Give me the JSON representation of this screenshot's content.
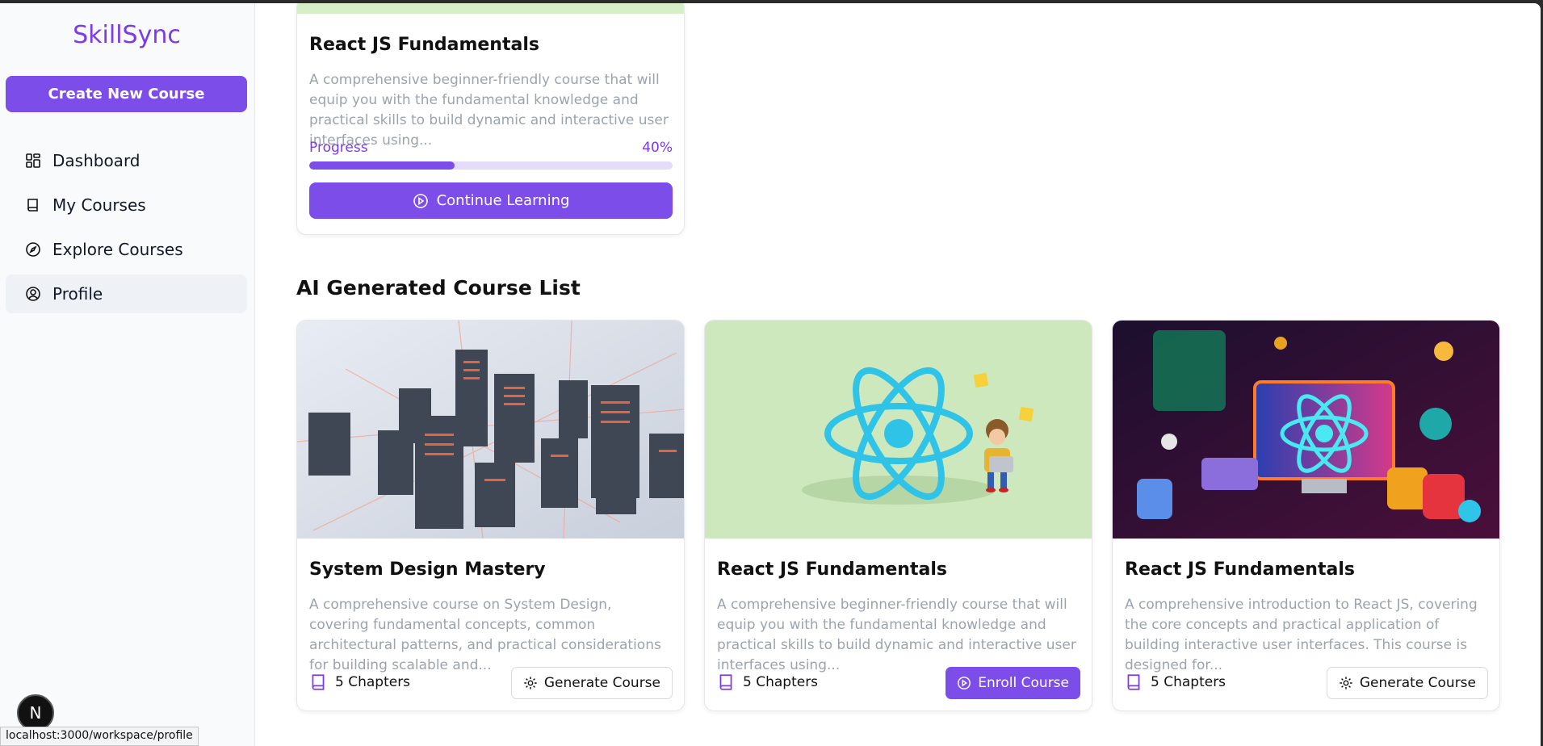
{
  "sidebar": {
    "brand": "SkillSync",
    "create_label": "Create New Course",
    "items": [
      {
        "label": "Dashboard",
        "icon": "dashboard-icon"
      },
      {
        "label": "My Courses",
        "icon": "book-icon"
      },
      {
        "label": "Explore Courses",
        "icon": "compass-icon"
      },
      {
        "label": "Profile",
        "icon": "user-circle-icon",
        "active": true
      }
    ]
  },
  "enrolled": {
    "title": "React JS Fundamentals",
    "description": "A comprehensive beginner-friendly course that will equip you with the fundamental knowledge and practical skills to build dynamic and interactive user interfaces using...",
    "progress_label": "Progress",
    "progress_value": "40%",
    "progress_fraction": 0.4,
    "button_label": "Continue Learning"
  },
  "section_title": "AI Generated Course List",
  "courses": [
    {
      "title": "System Design Mastery",
      "description": "A comprehensive course on System Design, covering fundamental concepts, common architectural patterns, and practical considerations for building scalable and...",
      "chapters": "5 Chapters",
      "action": "Generate Course"
    },
    {
      "title": "React JS Fundamentals",
      "description": "A comprehensive beginner-friendly course that will equip you with the fundamental knowledge and practical skills to build dynamic and interactive user interfaces using...",
      "chapters": "5 Chapters",
      "action": "Enroll Course"
    },
    {
      "title": "React JS Fundamentals",
      "description": "A comprehensive introduction to React JS, covering the core concepts and practical application of building interactive user interfaces. This course is designed for...",
      "chapters": "5 Chapters",
      "action": "Generate Course"
    }
  ],
  "status_url": "localhost:3000/workspace/profile",
  "next_badge": "N",
  "colors": {
    "accent": "#7c4de9",
    "brand": "#7c3aed"
  }
}
